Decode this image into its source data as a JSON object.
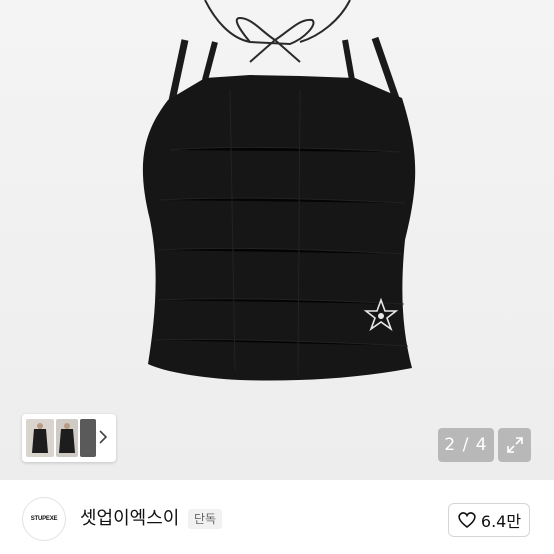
{
  "gallery": {
    "page_counter": "2 / 4",
    "expand_icon": "expand-arrows-icon",
    "thumbnail_next_icon": "chevron-right-icon",
    "product_image": "black-halter-camisole-with-star-logo"
  },
  "seller": {
    "logo_text": "STUPEXE",
    "name": "셋업이엑스이",
    "badge": "단독"
  },
  "like": {
    "icon": "heart-outline-icon",
    "count": "6.4만"
  },
  "colors": {
    "garment": "#161616",
    "badge_bg": "#f1f1f1",
    "counter_bg": "#8c8c8c"
  }
}
